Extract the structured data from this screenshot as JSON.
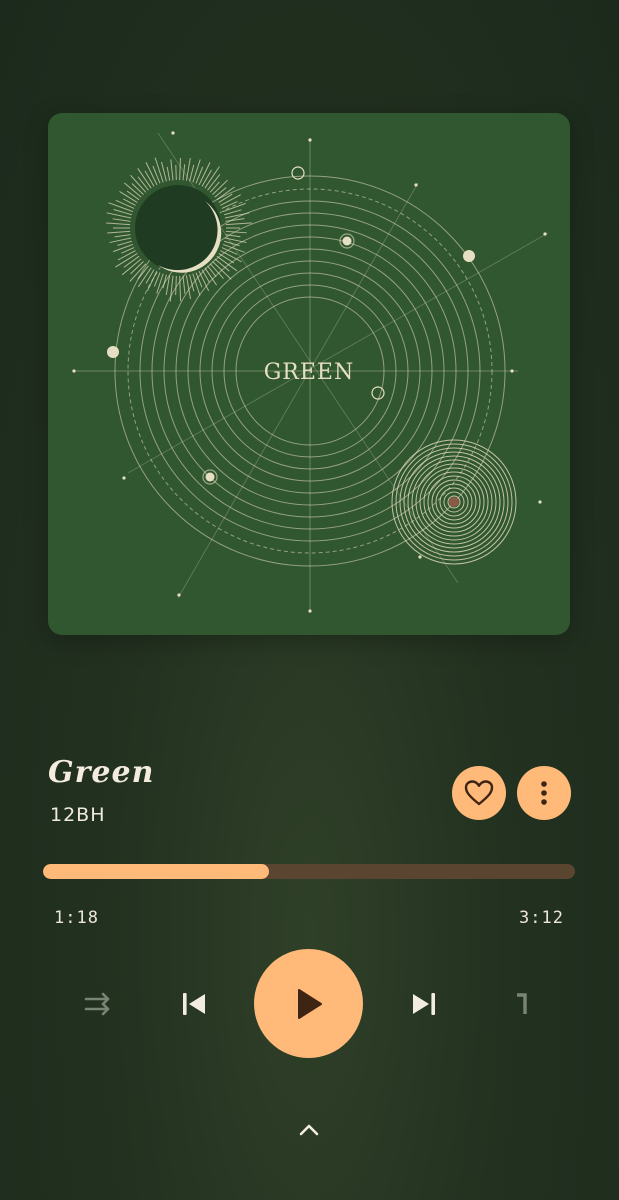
{
  "album": {
    "cover_text": "GREEN"
  },
  "track": {
    "title": "Green",
    "artist": "12BH"
  },
  "playback": {
    "progress_fraction": 0.425,
    "elapsed": "1:18",
    "total": "3:12"
  },
  "controls": {
    "like_icon": "heart-outline-icon",
    "more_icon": "more-vertical-icon",
    "shuffle_icon": "shuffle-icon",
    "prev_icon": "skip-previous-icon",
    "play_icon": "play-icon",
    "next_icon": "skip-next-icon",
    "repeat_icon": "repeat-one-icon",
    "expand_icon": "chevron-up-icon"
  },
  "colors": {
    "background": "#1f2d1e",
    "accent": "#ffba7a",
    "progress_remaining": "#5a4531",
    "album_bg": "#30572f",
    "album_lines": "#e7dfc3",
    "icon_dark": "#3e2413",
    "icon_muted": "#7a8475",
    "text": "#f4ecdf"
  }
}
